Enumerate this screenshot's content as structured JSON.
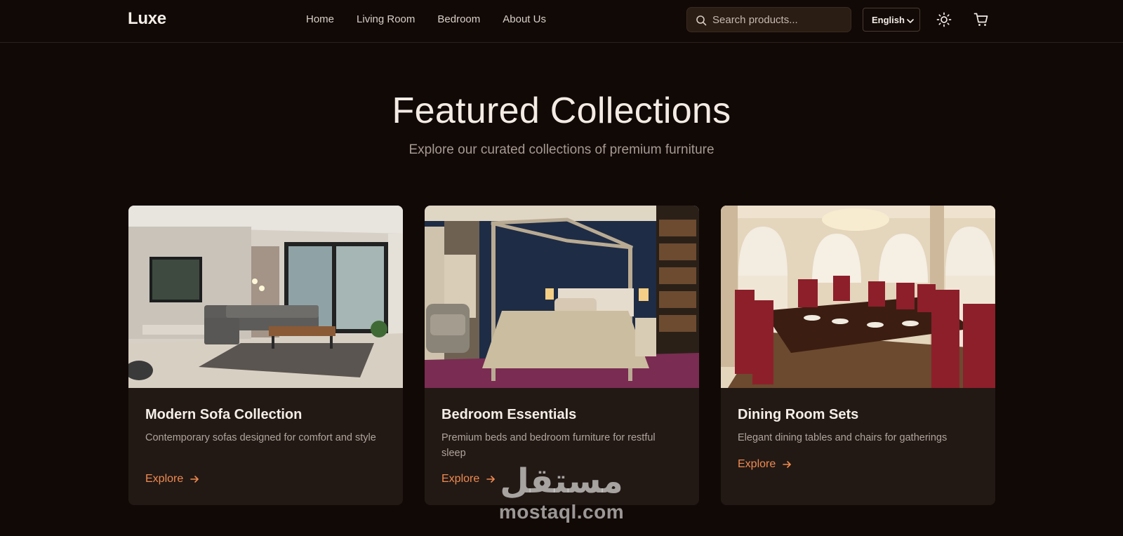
{
  "header": {
    "logo": "Luxe",
    "nav": [
      "Home",
      "Living Room",
      "Bedroom",
      "About Us"
    ],
    "search_placeholder": "Search products...",
    "language": "English",
    "icons": {
      "search": "search-icon",
      "theme": "sun-icon",
      "cart": "cart-icon",
      "language": "chevron-down-icon"
    }
  },
  "hero": {
    "title": "Featured Collections",
    "subtitle": "Explore our curated collections of premium furniture"
  },
  "collections": [
    {
      "title": "Modern Sofa Collection",
      "description": "Contemporary sofas designed for comfort and style",
      "link": "Explore",
      "image": "modern living room with grey sectional sofa"
    },
    {
      "title": "Bedroom Essentials",
      "description": "Premium beds and bedroom furniture for restful sleep",
      "link": "Explore",
      "image": "bedroom with canopy bed and navy walls"
    },
    {
      "title": "Dining Room Sets",
      "description": "Elegant dining tables and chairs for gatherings",
      "link": "Explore",
      "image": "dining room with long table and red velvet chairs"
    }
  ],
  "watermark": {
    "arabic": "مستقل",
    "latin": "mostaql.com"
  },
  "colors": {
    "background": "#110906",
    "card": "#221915",
    "accent": "#ef8a4f",
    "text": "#f4ece4",
    "muted": "#a69a91"
  }
}
